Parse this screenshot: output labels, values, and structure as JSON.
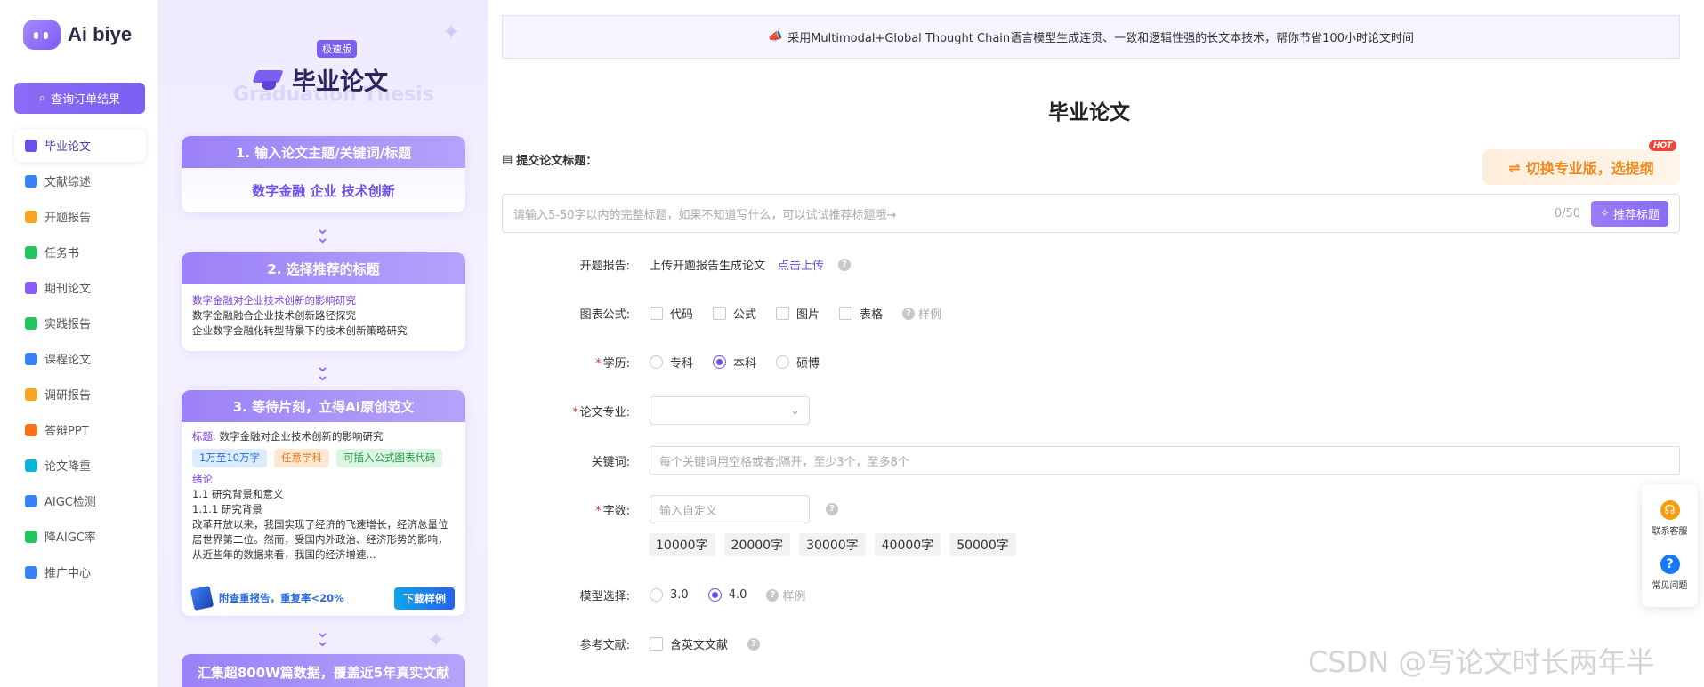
{
  "brand": {
    "name": "Ai biye"
  },
  "nav": {
    "query_button": "查询订单结果",
    "items": [
      {
        "label": "毕业论文",
        "icon": "graduation-cap-icon",
        "color": "#6c4fe8"
      },
      {
        "label": "文献综述",
        "icon": "document-icon",
        "color": "#3b82f6"
      },
      {
        "label": "开题报告",
        "icon": "report-icon",
        "color": "#f5a623"
      },
      {
        "label": "任务书",
        "icon": "checklist-icon",
        "color": "#22c55e"
      },
      {
        "label": "期刊论文",
        "icon": "journal-icon",
        "color": "#8b5cf6"
      },
      {
        "label": "实践报告",
        "icon": "practice-icon",
        "color": "#22c55e"
      },
      {
        "label": "课程论文",
        "icon": "course-icon",
        "color": "#3b82f6"
      },
      {
        "label": "调研报告",
        "icon": "survey-icon",
        "color": "#f5a623"
      },
      {
        "label": "答辩PPT",
        "icon": "ppt-icon",
        "color": "#f97316"
      },
      {
        "label": "论文降重",
        "icon": "reduce-icon",
        "color": "#06b6d4"
      },
      {
        "label": "AIGC检测",
        "icon": "aigc-detect-icon",
        "color": "#3b82f6"
      },
      {
        "label": "降AIGC率",
        "icon": "aigc-reduce-icon",
        "color": "#22c55e"
      },
      {
        "label": "推广中心",
        "icon": "promotion-icon",
        "color": "#3b82f6"
      }
    ]
  },
  "promo": {
    "badge": "极速版",
    "title": "毕业论文",
    "ghost_title": "Graduation Thesis",
    "step1": {
      "heading": "1. 输入论文主题/关键词/标题",
      "content": "数字金融 企业 技术创新"
    },
    "step2": {
      "heading": "2. 选择推荐的标题",
      "lines": [
        "数字金融对企业技术创新的影响研究",
        "数字金融融合企业技术创新路径探究",
        "企业数字金融化转型背景下的技术创新策略研究"
      ]
    },
    "step3": {
      "heading": "3. 等待片刻，立得AI原创范文",
      "title_label": "标题:",
      "title_value": "数字金融对企业技术创新的影响研究",
      "chips": [
        "1万至10万字",
        "任意学科",
        "可插入公式图表代码"
      ],
      "section": "绪论",
      "sub1": "1.1 研究背景和意义",
      "sub2": "1.1.1 研究背景",
      "paragraph": "改革开放以来，我国实现了经济的飞速增长，经济总量位居世界第二位。然而，受国内外政治、经济形势的影响，从近些年的数据来看，我国的经济增速...",
      "footer_text": "附查重报告，重复率<20%",
      "download": "下载样例"
    },
    "step4": "汇集超800W篇数据，覆盖近5年真实文献"
  },
  "banner": "采用Multimodal+Global Thought Chain语言模型生成连贯、一致和逻辑性强的长文本技术，帮你节省100小时论文时间",
  "form": {
    "page_title": "毕业论文",
    "submit_label": "提交论文标题：",
    "switch_button": "切换专业版，选提纲",
    "hot": "HOT",
    "title_placeholder": "请输入5-50字以内的完整标题，如果不知道写什么，可以试试推荐标题哦→",
    "counter": "0/50",
    "recommend_button": "推荐标题",
    "proposal": {
      "label": "开题报告:",
      "text": "上传开题报告生成论文",
      "link": "点击上传"
    },
    "figures": {
      "label": "图表公式:",
      "options": [
        "代码",
        "公式",
        "图片",
        "表格"
      ],
      "sample": "样例"
    },
    "degree": {
      "label": "学历:",
      "options": [
        "专科",
        "本科",
        "硕博"
      ],
      "selected": "本科"
    },
    "major": {
      "label": "论文专业:",
      "value": ""
    },
    "keywords": {
      "label": "关键词:",
      "placeholder": "每个关键词用空格或者;隔开，至少3个，至多8个"
    },
    "word_count": {
      "label": "字数:",
      "placeholder": "输入自定义",
      "chips": [
        "10000字",
        "20000字",
        "30000字",
        "40000字",
        "50000字"
      ]
    },
    "model": {
      "label": "模型选择:",
      "options": [
        "3.0",
        "4.0"
      ],
      "selected": "4.0",
      "sample": "样例"
    },
    "references": {
      "label": "参考文献:",
      "option": "含英文文献"
    }
  },
  "float_panel": {
    "service": "联系客服",
    "faq": "常见问题"
  },
  "watermark": "CSDN @写论文时长两年半"
}
